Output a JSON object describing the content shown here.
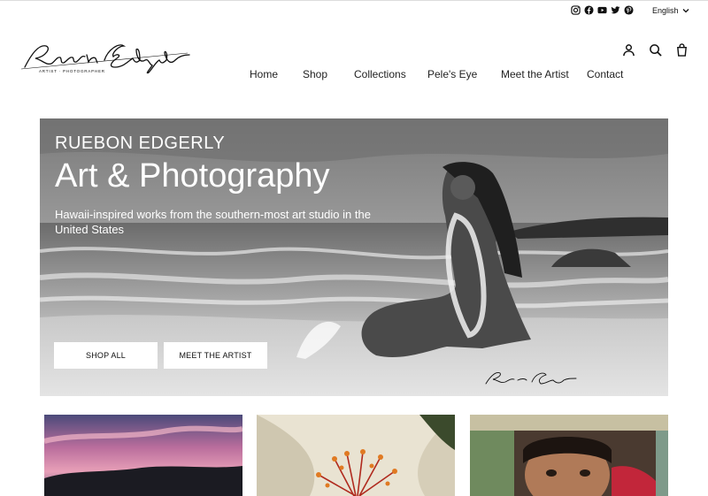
{
  "topbar": {
    "social_icons": [
      "instagram-icon",
      "facebook-icon",
      "youtube-icon",
      "twitter-icon",
      "pinterest-icon"
    ],
    "language": "English"
  },
  "header": {
    "logo_script": "Ruebón Edgerly",
    "logo_tagline": "ARTIST · PHOTOGRAPHER",
    "icons": [
      "account-icon",
      "search-icon",
      "cart-icon"
    ]
  },
  "nav": {
    "items": [
      {
        "label": "Home"
      },
      {
        "label": "Shop"
      },
      {
        "label": "Collections"
      },
      {
        "label": "Pele's Eye"
      },
      {
        "label": "Meet the Artist"
      },
      {
        "label": "Contact"
      }
    ]
  },
  "hero": {
    "subtitle": "RUEBON EDGERLY",
    "title": "Art & Photography",
    "description": "Hawaii-inspired works from the southern-most art studio in the United States",
    "buttons": {
      "shop_all": "SHOP ALL",
      "meet_artist": "MEET THE ARTIST"
    },
    "signature": "Ruebón Edgerly"
  },
  "tiles": [
    "sunset-lava-photo",
    "hibiscus-flower-photo",
    "child-portrait-photo"
  ],
  "colors": {
    "text": "#222222",
    "hero_bg": "#8a8a8a",
    "button_bg": "#ffffff"
  }
}
